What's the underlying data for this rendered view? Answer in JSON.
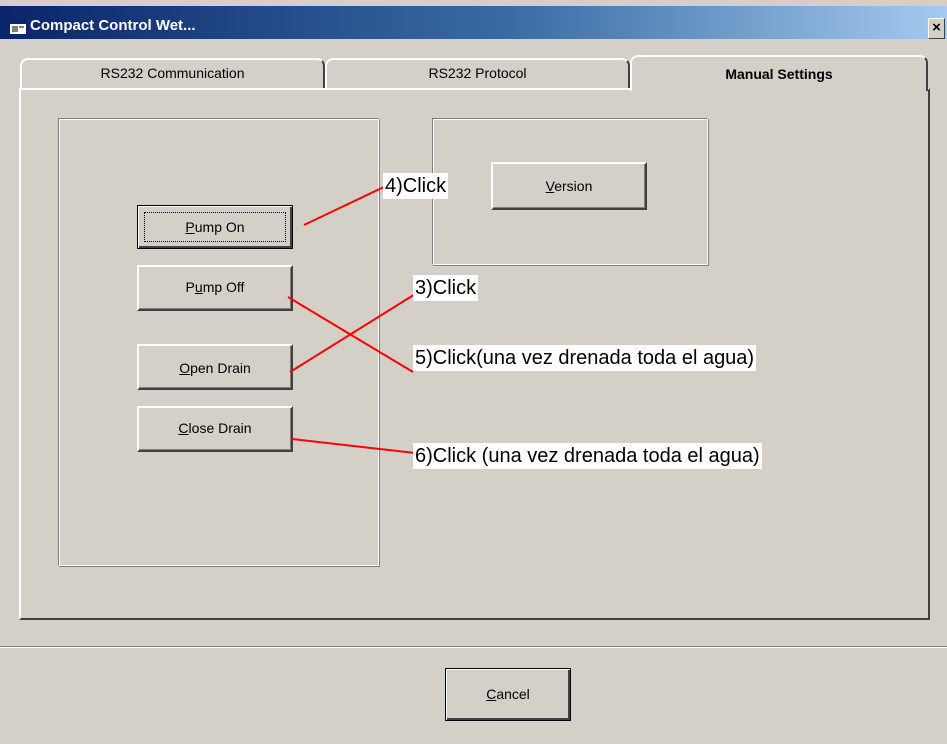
{
  "window": {
    "title": "Compact Control Wet...",
    "close_glyph": "×"
  },
  "tabs": [
    {
      "label": "RS232 Communication"
    },
    {
      "label": "RS232 Protocol"
    },
    {
      "label": "Manual Settings",
      "selected": true
    }
  ],
  "buttons": {
    "pump_on": {
      "mnemonic": "P",
      "rest": "ump On"
    },
    "pump_off": {
      "pre": "P",
      "mnemonic": "u",
      "rest": "mp Off"
    },
    "open_drain": {
      "mnemonic": "O",
      "rest": "pen Drain"
    },
    "close_drain": {
      "mnemonic": "C",
      "rest": "lose Drain"
    },
    "version": {
      "mnemonic": "V",
      "rest": "ersion"
    },
    "cancel": {
      "mnemonic": "C",
      "rest": "ancel"
    }
  },
  "annotations": {
    "step_4": "4)Click",
    "step_3": "3)Click",
    "step_5": "5)Click(una vez drenada toda el agua)",
    "step_6": "6)Click (una vez drenada toda el agua)"
  },
  "colors": {
    "face": "#d4d0c8",
    "title_start": "#0a246a",
    "title_end": "#a6caf0",
    "annotation_line": "#ff0000"
  },
  "icons": {
    "title": "app-window-icon",
    "close": "close-icon"
  }
}
